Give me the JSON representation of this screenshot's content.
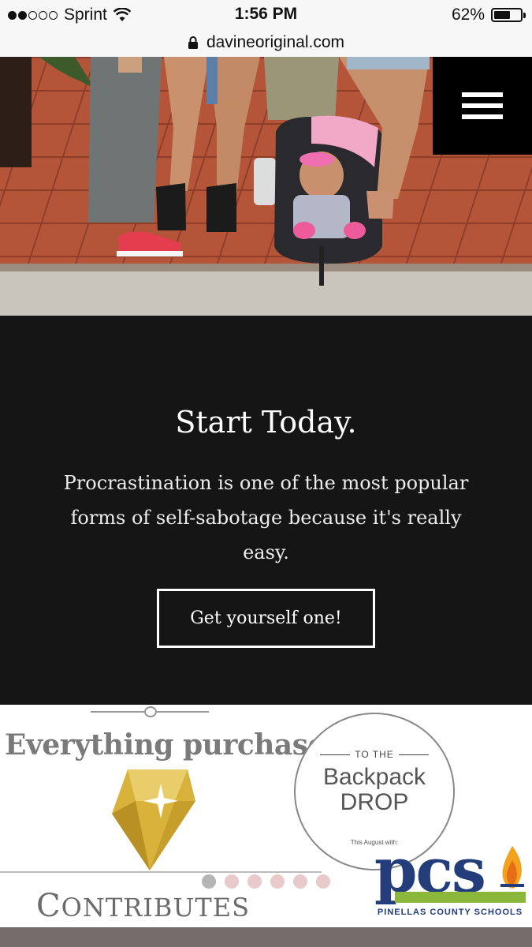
{
  "status_bar": {
    "carrier": "Sprint",
    "time": "1:56 PM",
    "battery_percent": "62%",
    "battery_level": 0.62,
    "signal_bars": 2,
    "signal_total": 5
  },
  "url_bar": {
    "domain": "davineoriginal.com"
  },
  "hero": {
    "icon": "menu-icon"
  },
  "cta_section": {
    "title": "Start Today.",
    "body": "Procrastination is one of the most popular forms of self-sabotage because it's really easy.",
    "button_label": "Get yourself one!"
  },
  "promo": {
    "headline": "Everything purchased",
    "contributes_first": "C",
    "contributes_rest": "ONTRIBUTES",
    "backpack_small": "TO THE",
    "backpack_line1": "Backpack",
    "backpack_line2": "DROP",
    "backpack_sub": "This August with:",
    "pcs_letters": "pcs",
    "pcs_name": "PINELLAS COUNTY SCHOOLS",
    "carousel_count": 6,
    "carousel_active": 0
  },
  "colors": {
    "dark_bg": "#151515",
    "accent_gold": "#d8b23a",
    "pcs_blue": "#223d7a",
    "pcs_green": "#8bb83b",
    "dot_inactive": "#e8c9cc",
    "dot_active": "#b5b5b5"
  }
}
